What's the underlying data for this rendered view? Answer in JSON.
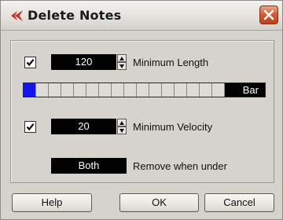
{
  "window": {
    "title": "Delete Notes",
    "close_icon": "close-x-icon",
    "logo_icon": "cubase-logo-icon",
    "accent_color": "#c0392b"
  },
  "min_length": {
    "checked": true,
    "value": "120",
    "label": "Minimum Length"
  },
  "length_slider": {
    "segments": 16,
    "active_segments": 1,
    "active_color": "#1515e6",
    "mode_label": "Bar"
  },
  "min_velocity": {
    "checked": true,
    "value": "20",
    "label": "Minimum Velocity"
  },
  "remove": {
    "value": "Both",
    "label": "Remove when under"
  },
  "buttons": {
    "help": "Help",
    "ok": "OK",
    "cancel": "Cancel"
  }
}
